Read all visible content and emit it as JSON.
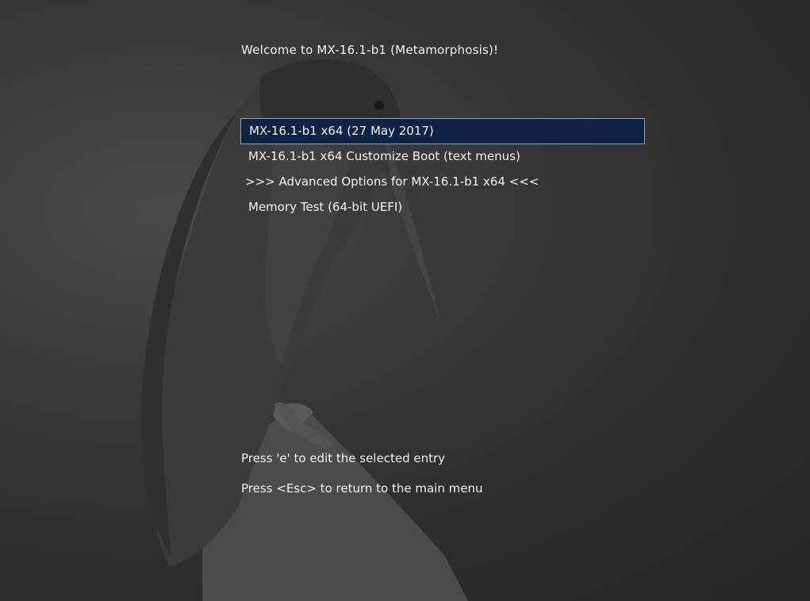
{
  "header": {
    "welcome": "Welcome to MX-16.1-b1 (Metamorphosis)!"
  },
  "menu": {
    "items": [
      {
        "label": "MX-16.1-b1 x64 (27 May 2017)",
        "selected": true
      },
      {
        "label": "MX-16.1-b1 x64 Customize Boot (text menus)",
        "selected": false
      },
      {
        "label": ">>> Advanced Options for MX-16.1-b1 x64 <<<",
        "selected": false
      },
      {
        "label": "Memory Test (64-bit UEFI)",
        "selected": false
      }
    ]
  },
  "footer": {
    "edit_hint": "Press 'e' to edit the selected entry",
    "esc_hint": "Press <Esc> to return to the main menu"
  },
  "theme": {
    "background": "#2e2e2e",
    "selection_fill": "#0f2444",
    "selection_border": "#9aa3ad",
    "text": "#f2f2f2"
  },
  "background_image": "kingfisher-bird-on-branch-greyscale"
}
